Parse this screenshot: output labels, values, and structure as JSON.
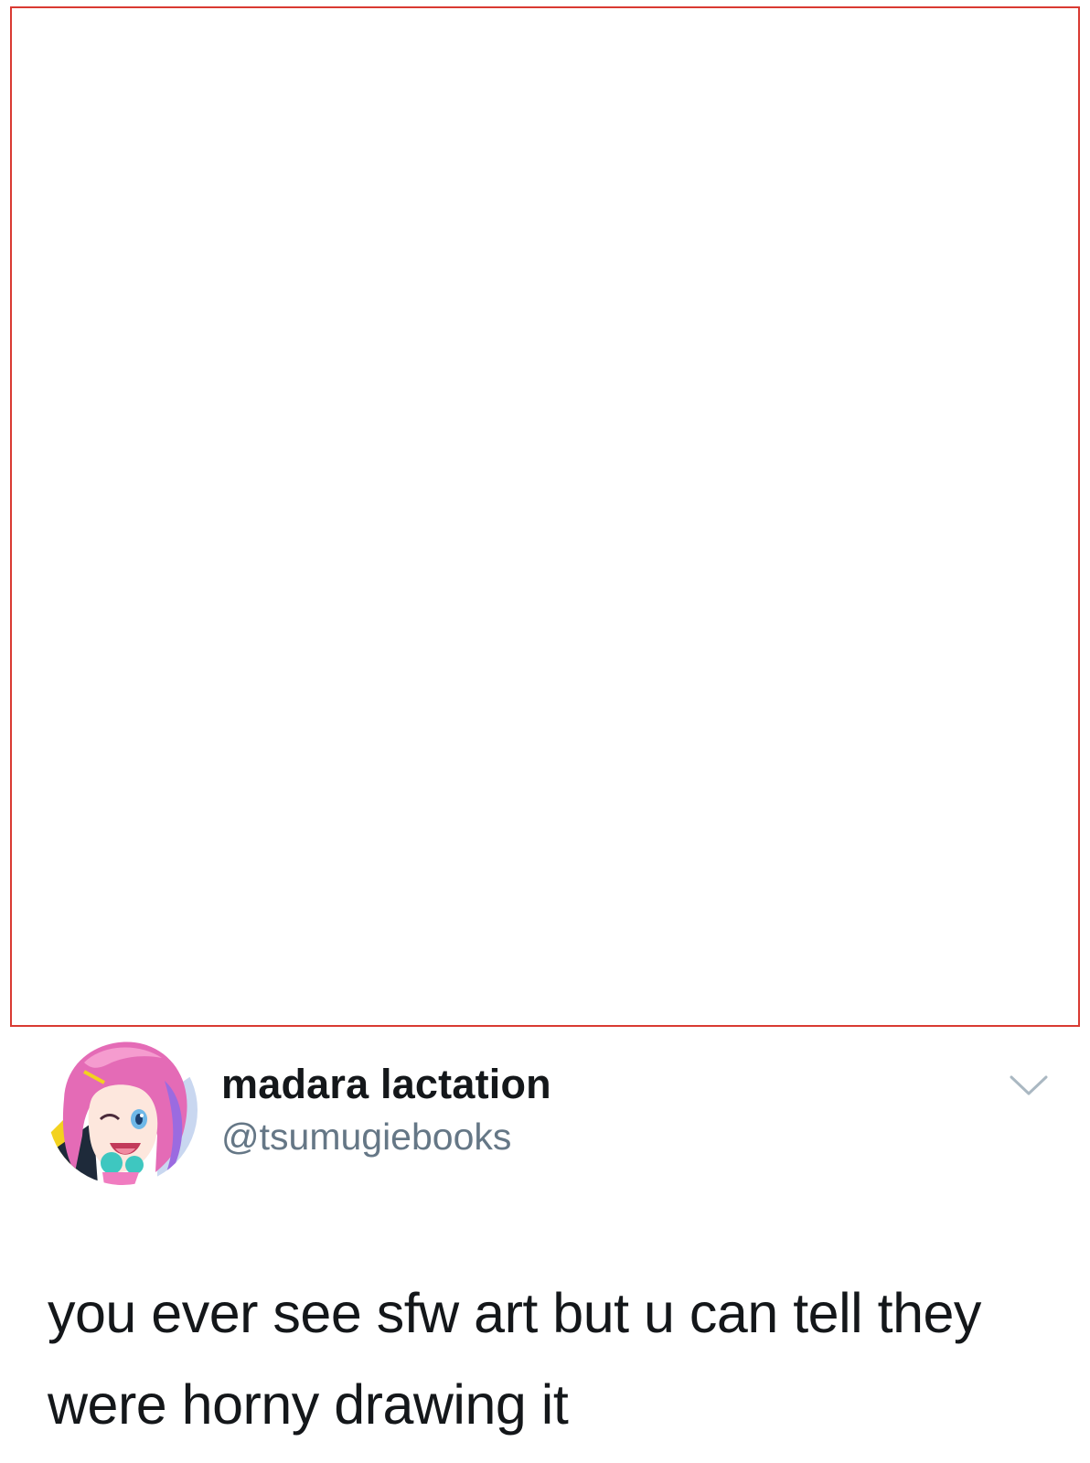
{
  "tweet": {
    "display_name": "madara lactation",
    "handle": "@tsumugiebooks",
    "text": "you ever see sfw art but u can tell they were horny drawing it",
    "avatar_icon": "anime-avatar",
    "menu_icon": "chevron-down-icon"
  },
  "colors": {
    "media_border": "#d93a32",
    "name": "#14171a",
    "handle": "#657786",
    "caret": "#aab8c2"
  }
}
